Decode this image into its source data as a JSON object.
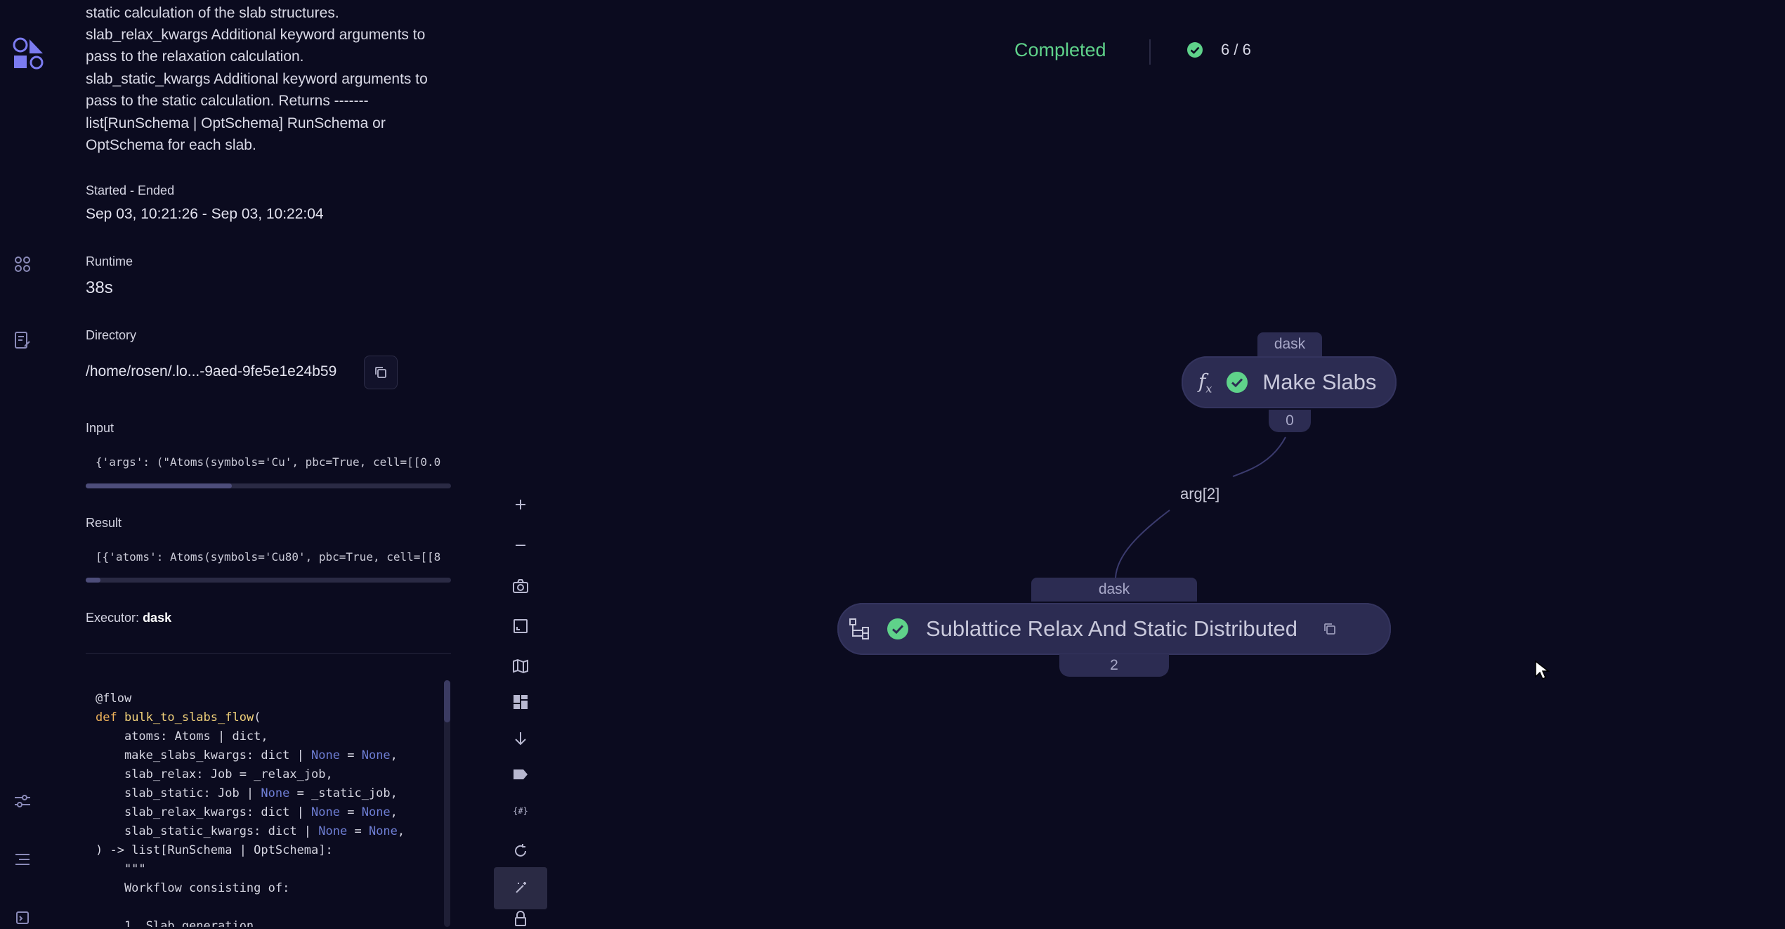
{
  "description_lines": [
    "static calculation of the slab structures.",
    "slab_relax_kwargs Additional keyword arguments to",
    "pass to the relaxation calculation.",
    "slab_static_kwargs Additional keyword arguments to",
    "pass to the static calculation. Returns -------",
    "list[RunSchema | OptSchema] RunSchema or",
    "OptSchema for each slab."
  ],
  "details": {
    "started_ended_label": "Started - Ended",
    "started_ended_value": "Sep 03, 10:21:26 - Sep 03, 10:22:04",
    "runtime_label": "Runtime",
    "runtime_value": "38s",
    "directory_label": "Directory",
    "directory_value": "/home/rosen/.lo...-9aed-9fe5e1e24b59",
    "input_label": "Input",
    "input_value": "{'args': (\"Atoms(symbols='Cu', pbc=True, cell=[[0.0",
    "input_scroll_fraction": 0.4,
    "result_label": "Result",
    "result_value": "[{'atoms': Atoms(symbols='Cu80', pbc=True, cell=[[8",
    "result_scroll_fraction": 0.04,
    "executor_label": "Executor:",
    "executor_value": "dask"
  },
  "code_lines": [
    "@flow",
    "def bulk_to_slabs_flow(",
    "    atoms: Atoms | dict,",
    "    make_slabs_kwargs: dict | None = None,",
    "    slab_relax: Job = _relax_job,",
    "    slab_static: Job | None = _static_job,",
    "    slab_relax_kwargs: dict | None = None,",
    "    slab_static_kwargs: dict | None = None,",
    ") -> list[RunSchema | OptSchema]:",
    "    \"\"\"",
    "    Workflow consisting of:",
    "",
    "    1. Slab generation"
  ],
  "canvas": {
    "status_text": "Completed",
    "count_text": "6 / 6",
    "colors": {
      "success": "#5fd28a",
      "node": "#2c2c52",
      "accent": "#7b7bf0"
    },
    "nodes": [
      {
        "executor": "dask",
        "title": "Make Slabs",
        "node_id": "0",
        "kind": "function"
      },
      {
        "executor": "dask",
        "title": "Sublattice Relax And Static Distributed",
        "node_id": "2",
        "kind": "sublattice"
      }
    ],
    "edge_label": "arg[2]"
  },
  "toolbar": [
    "zoom-in",
    "zoom-out",
    "screenshot",
    "fit-view",
    "minimap",
    "layout",
    "arrange-down",
    "labels",
    "parameters",
    "refresh",
    "highlight",
    "lock"
  ]
}
